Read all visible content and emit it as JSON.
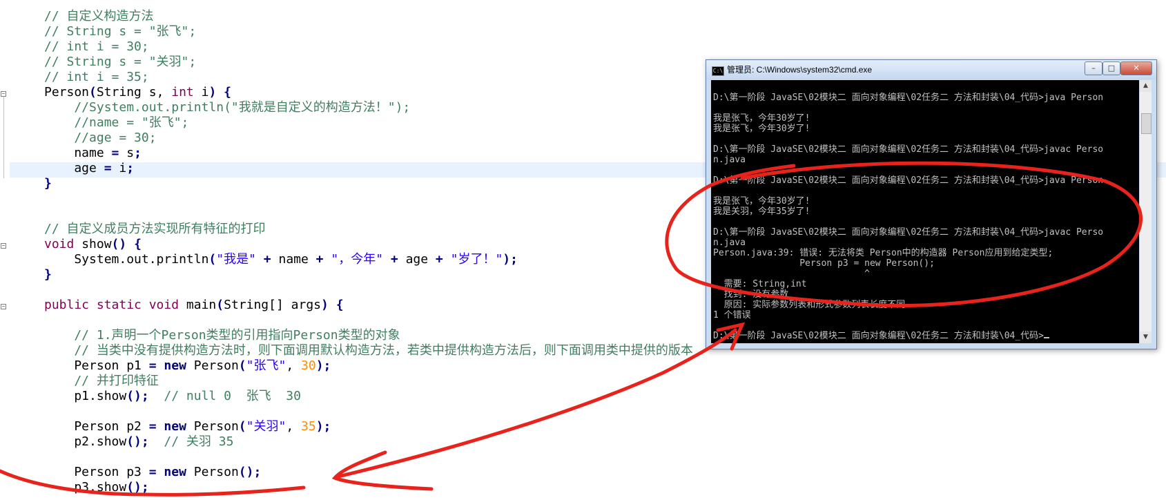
{
  "editor": {
    "lines": [
      [
        {
          "t": "// 自定义构造方法",
          "c": "c"
        }
      ],
      [
        {
          "t": "// String s = \"张飞\";",
          "c": "c"
        }
      ],
      [
        {
          "t": "// int i = 30;",
          "c": "c"
        }
      ],
      [
        {
          "t": "// String s = \"关羽\";",
          "c": "c"
        }
      ],
      [
        {
          "t": "// int i = 35;",
          "c": "c"
        }
      ],
      [
        {
          "t": "Person",
          "c": ""
        },
        {
          "t": "(",
          "c": "op"
        },
        {
          "t": "String s, ",
          "c": ""
        },
        {
          "t": "int",
          "c": "k"
        },
        {
          "t": " i",
          "c": ""
        },
        {
          "t": ")",
          "c": "op"
        },
        {
          "t": " ",
          "c": ""
        },
        {
          "t": "{",
          "c": "op"
        }
      ],
      [
        {
          "t": "    //System.out.println(\"我就是自定义的构造方法！\");",
          "c": "c"
        }
      ],
      [
        {
          "t": "    //name = \"张飞\";",
          "c": "c"
        }
      ],
      [
        {
          "t": "    //age = 30;",
          "c": "c"
        }
      ],
      [
        {
          "t": "    name ",
          "c": ""
        },
        {
          "t": "=",
          "c": "op"
        },
        {
          "t": " s",
          "c": ""
        },
        {
          "t": ";",
          "c": "op"
        }
      ],
      [
        {
          "t": "    age ",
          "c": ""
        },
        {
          "t": "=",
          "c": "op"
        },
        {
          "t": " i",
          "c": ""
        },
        {
          "t": ";",
          "c": "op"
        }
      ],
      [
        {
          "t": "}",
          "c": "op"
        }
      ],
      [],
      [],
      [
        {
          "t": "// 自定义成员方法实现所有特征的打印",
          "c": "c"
        }
      ],
      [
        {
          "t": "void",
          "c": "k"
        },
        {
          "t": " show",
          "c": ""
        },
        {
          "t": "()",
          "c": "op"
        },
        {
          "t": " ",
          "c": ""
        },
        {
          "t": "{",
          "c": "op"
        }
      ],
      [
        {
          "t": "    System.out.println",
          "c": ""
        },
        {
          "t": "(",
          "c": "op"
        },
        {
          "t": "\"我是\"",
          "c": "s"
        },
        {
          "t": " ",
          "c": ""
        },
        {
          "t": "+",
          "c": "op"
        },
        {
          "t": " name ",
          "c": ""
        },
        {
          "t": "+",
          "c": "op"
        },
        {
          "t": " ",
          "c": ""
        },
        {
          "t": "\"，今年\"",
          "c": "s"
        },
        {
          "t": " ",
          "c": ""
        },
        {
          "t": "+",
          "c": "op"
        },
        {
          "t": " age ",
          "c": ""
        },
        {
          "t": "+",
          "c": "op"
        },
        {
          "t": " ",
          "c": ""
        },
        {
          "t": "\"岁了！\"",
          "c": "s"
        },
        {
          "t": ");",
          "c": "op"
        }
      ],
      [
        {
          "t": "}",
          "c": "op"
        }
      ],
      [],
      [
        {
          "t": "public static void",
          "c": "k"
        },
        {
          "t": " main",
          "c": ""
        },
        {
          "t": "(",
          "c": "op"
        },
        {
          "t": "String[] args",
          "c": ""
        },
        {
          "t": ")",
          "c": "op"
        },
        {
          "t": " ",
          "c": ""
        },
        {
          "t": "{",
          "c": "op"
        }
      ],
      [],
      [
        {
          "t": "    // 1.声明一个Person类型的引用指向Person类型的对象",
          "c": "c"
        }
      ],
      [
        {
          "t": "    // 当类中没有提供构造方法时，则下面调用默认构造方法，若类中提供构造方法后，则下面调用类中提供的版本",
          "c": "c"
        }
      ],
      [
        {
          "t": "    Person p1 ",
          "c": ""
        },
        {
          "t": "=",
          "c": "op"
        },
        {
          "t": " ",
          "c": ""
        },
        {
          "t": "new",
          "c": "op"
        },
        {
          "t": " Person",
          "c": ""
        },
        {
          "t": "(",
          "c": "op"
        },
        {
          "t": "\"张飞\"",
          "c": "s"
        },
        {
          "t": ", ",
          "c": ""
        },
        {
          "t": "30",
          "c": "n"
        },
        {
          "t": ");",
          "c": "op"
        }
      ],
      [
        {
          "t": "    // 并打印特征",
          "c": "c"
        }
      ],
      [
        {
          "t": "    p1.show",
          "c": ""
        },
        {
          "t": "();",
          "c": "op"
        },
        {
          "t": "  // null 0  张飞  30",
          "c": "c"
        }
      ],
      [],
      [
        {
          "t": "    Person p2 ",
          "c": ""
        },
        {
          "t": "=",
          "c": "op"
        },
        {
          "t": " ",
          "c": ""
        },
        {
          "t": "new",
          "c": "op"
        },
        {
          "t": " Person",
          "c": ""
        },
        {
          "t": "(",
          "c": "op"
        },
        {
          "t": "\"关羽\"",
          "c": "s"
        },
        {
          "t": ", ",
          "c": ""
        },
        {
          "t": "35",
          "c": "n"
        },
        {
          "t": ");",
          "c": "op"
        }
      ],
      [
        {
          "t": "    p2.show",
          "c": ""
        },
        {
          "t": "();",
          "c": "op"
        },
        {
          "t": "  // 关羽 35",
          "c": "c"
        }
      ],
      [],
      [
        {
          "t": "    Person p3 ",
          "c": ""
        },
        {
          "t": "=",
          "c": "op"
        },
        {
          "t": " ",
          "c": ""
        },
        {
          "t": "new",
          "c": "op"
        },
        {
          "t": " Person",
          "c": ""
        },
        {
          "t": "();",
          "c": "op"
        }
      ],
      [
        {
          "t": "    p3.show",
          "c": ""
        },
        {
          "t": "();",
          "c": "op"
        }
      ]
    ]
  },
  "cmd": {
    "title": "管理员: C:\\Windows\\system32\\cmd.exe",
    "icon_label": "C:\\",
    "buttons": {
      "minimize": "–",
      "maximize": "□",
      "close": "✕"
    },
    "lines": [
      "",
      "D:\\第一阶段 JavaSE\\02模块二 面向对象编程\\02任务二 方法和封装\\04_代码>java Person",
      "",
      "我是张飞，今年30岁了!",
      "我是张飞，今年30岁了!",
      "",
      "D:\\第一阶段 JavaSE\\02模块二 面向对象编程\\02任务二 方法和封装\\04_代码>javac Perso",
      "n.java",
      "",
      "D:\\第一阶段 JavaSE\\02模块二 面向对象编程\\02任务二 方法和封装\\04_代码>java Person",
      "",
      "我是张飞，今年30岁了!",
      "我是关羽，今年35岁了!",
      "",
      "D:\\第一阶段 JavaSE\\02模块二 面向对象编程\\02任务二 方法和封装\\04_代码>javac Perso",
      "n.java",
      "Person.java:39: 错误: 无法将类 Person中的构造器 Person应用到给定类型;",
      "                Person p3 = new Person();",
      "                            ^",
      "  需要: String,int",
      "  找到: 没有参数",
      "  原因: 实际参数列表和形式参数列表长度不同",
      "1 个错误",
      "",
      "D:\\第一阶段 JavaSE\\02模块二 面向对象编程\\02任务二 方法和封装\\04_代码>"
    ],
    "scroll_up": "▲",
    "scroll_down": "▼"
  },
  "colors": {
    "annotation": "#e8231c",
    "comment": "#3f7f5f",
    "keyword": "#7f0055",
    "string": "#2a00ff",
    "number": "#ff8c00"
  }
}
